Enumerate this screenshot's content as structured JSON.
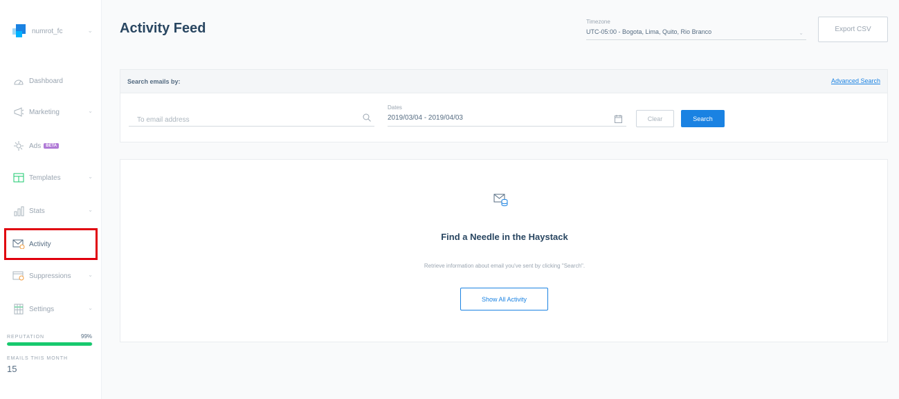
{
  "account": {
    "name": "numrot_fc"
  },
  "sidebar": {
    "items": [
      {
        "label": "Dashboard",
        "icon": "dashboard-icon"
      },
      {
        "label": "Marketing",
        "icon": "megaphone-icon"
      },
      {
        "label": "Ads",
        "icon": "ads-icon",
        "badge": "BETA"
      },
      {
        "label": "Templates",
        "icon": "templates-icon"
      },
      {
        "label": "Stats",
        "icon": "stats-icon"
      },
      {
        "label": "Activity",
        "icon": "activity-icon"
      },
      {
        "label": "Suppressions",
        "icon": "suppressions-icon"
      },
      {
        "label": "Settings",
        "icon": "settings-icon"
      }
    ],
    "reputation": {
      "label": "REPUTATION",
      "value": "99%",
      "fraction": 0.99
    },
    "emails": {
      "label": "EMAILS THIS MONTH",
      "value": "15"
    }
  },
  "header": {
    "title": "Activity Feed",
    "timezone_label": "Timezone",
    "timezone_value": "UTC-05:00 - Bogota, Lima, Quito, Rio Branco",
    "export_label": "Export CSV"
  },
  "search": {
    "title": "Search emails by:",
    "advanced_label": "Advanced Search",
    "email_placeholder": "To email address",
    "dates_label": "Dates",
    "dates_value": "2019/03/04 - 2019/04/03",
    "clear_label": "Clear",
    "search_label": "Search"
  },
  "empty_state": {
    "title": "Find a Needle in the Haystack",
    "text": "Retrieve information about email you've sent by clicking \"Search\".",
    "button_label": "Show All Activity"
  },
  "colors": {
    "accent": "#1a82e2",
    "highlight": "#e0000d",
    "reputation": "#18c96e",
    "beta": "#b07ad6"
  }
}
